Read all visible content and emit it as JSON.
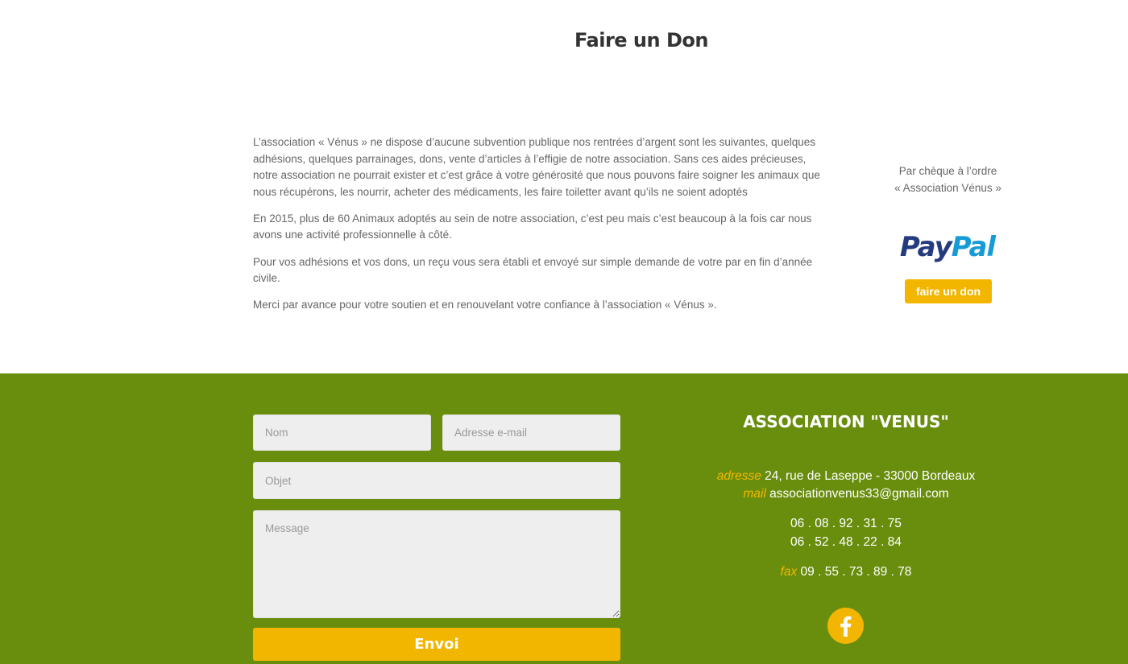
{
  "header": {
    "title": "Faire un Don"
  },
  "content": {
    "paragraphs": [
      "L’association « Vénus » ne dispose d’aucune subvention publique nos rentrées d’argent sont les suivantes, quelques adhésions, quelques parrainages, dons, vente d’articles à l’effigie de notre association. Sans ces aides précieuses, notre association ne pourrait exister et c’est grâce à votre générosité que nous pouvons faire soigner les animaux que nous récupérons, les nourrir, acheter des médicaments, les faire toiletter avant qu’ils ne soient adoptés",
      "En 2015, plus de 60 Animaux adoptés au sein de notre association, c’est peu mais c’est beaucoup à la fois car nous avons une activité professionnelle à côté.",
      "Pour vos adhésions et vos dons, un reçu vous sera établi et envoyé sur simple demande de votre par en fin d’année civile.",
      "Merci par avance pour votre soutien et en renouvelant votre confiance à l’association « Vénus »."
    ]
  },
  "sidebar": {
    "cheque_line1": "Par chèque à l’ordre",
    "cheque_line2": "« Association Vénus »",
    "paypal_logo_text": "PayPal",
    "don_button": "faire un don"
  },
  "form": {
    "nom_placeholder": "Nom",
    "email_placeholder": "Adresse e-mail",
    "objet_placeholder": "Objet",
    "message_placeholder": "Message",
    "submit_label": "Envoi"
  },
  "association": {
    "title": "ASSOCIATION \"VENUS\"",
    "address_label": "adresse",
    "address": "24, rue de Laseppe - 33000 Bordeaux",
    "mail_label": "mail",
    "mail": "associationvenus33@gmail.com",
    "phone1": "06 . 08 . 92 . 31 . 75",
    "phone2": "06 . 52 . 48 . 22 . 84",
    "fax_label": "fax",
    "fax": "09 . 55 . 73 . 89 . 78",
    "facebook_icon": "facebook-icon"
  },
  "colors": {
    "accent": "#f3b600",
    "footer_bg": "#698e0e",
    "paypal_dark": "#253b80",
    "paypal_light": "#179bd7"
  }
}
